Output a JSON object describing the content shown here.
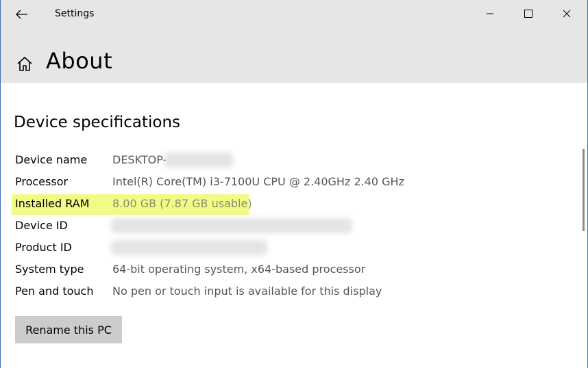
{
  "window": {
    "title": "Settings"
  },
  "header": {
    "title": "About"
  },
  "specs": {
    "section_title": "Device specifications",
    "rows": [
      {
        "label": "Device name",
        "value": "DESKTOP-"
      },
      {
        "label": "Processor",
        "value": "Intel(R) Core(TM) i3-7100U CPU @ 2.40GHz   2.40 GHz"
      },
      {
        "label": "Installed RAM",
        "value": "8.00 GB (7.87 GB usable)"
      },
      {
        "label": "Device ID",
        "value": ""
      },
      {
        "label": "Product ID",
        "value": ""
      },
      {
        "label": "System type",
        "value": "64-bit operating system, x64-based processor"
      },
      {
        "label": "Pen and touch",
        "value": "No pen or touch input is available for this display"
      }
    ]
  },
  "actions": {
    "rename_label": "Rename this PC"
  },
  "colors": {
    "highlight": "#f1fb85",
    "header_bg": "#e6e6e6",
    "button_bg": "#cccccc"
  }
}
